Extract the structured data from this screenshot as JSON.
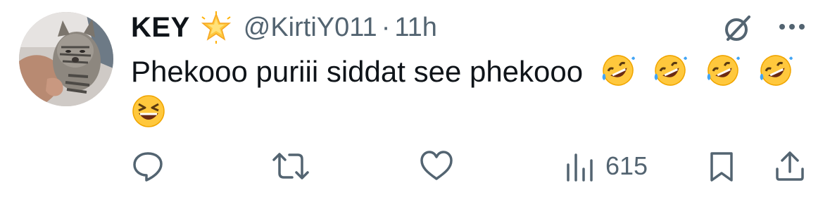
{
  "tweet": {
    "display_name": "KEY",
    "badge_icon": "glowing-star-icon",
    "handle": "@KirtiY011",
    "separator": "·",
    "time": "11h",
    "text": "Phekooo puriii siddat see phekooo",
    "emojis": [
      "rolling-on-floor-laughing-icon",
      "rolling-on-floor-laughing-icon",
      "rolling-on-floor-laughing-icon",
      "rolling-on-floor-laughing-icon",
      "grinning-squinting-face-icon"
    ]
  },
  "actions": {
    "reply_icon": "reply-icon",
    "retweet_icon": "retweet-icon",
    "like_icon": "heart-icon",
    "views_icon": "views-icon",
    "views_count": "615",
    "bookmark_icon": "bookmark-icon",
    "share_icon": "share-icon"
  },
  "colors": {
    "text_primary": "#0f1419",
    "text_secondary": "#536471",
    "icon": "#536471"
  }
}
